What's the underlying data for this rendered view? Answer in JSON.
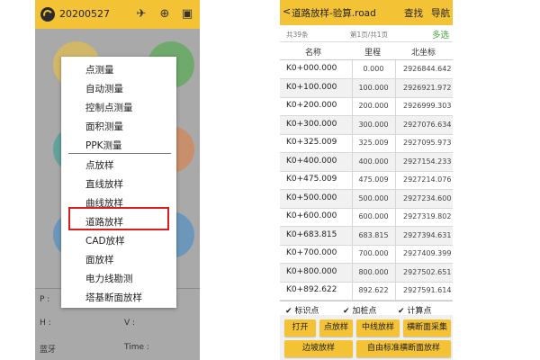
{
  "left": {
    "code": "20200527",
    "menu": {
      "items": [
        "点测量",
        "自动测量",
        "控制点测量",
        "面积测量",
        "PPK测量",
        "点放样",
        "直线放样",
        "曲线放样",
        "道路放样",
        "CAD放样",
        "面放样",
        "电力线勘测",
        "塔基断面放样"
      ],
      "highlighted_index": 8
    },
    "info": {
      "p": "P :",
      "h": "H :",
      "v": "V :",
      "bluetooth": "蓝牙",
      "time": "Time :"
    }
  },
  "right": {
    "title": "道路放样-验算.road",
    "back": "<",
    "find": "查找",
    "nav": "导航",
    "total": "共39条",
    "page": "第1页/共1页",
    "multi_select": "多选",
    "columns": [
      "名称",
      "里程",
      "北坐标"
    ],
    "rows": [
      [
        "K0+000.000",
        "0.000",
        "2926844.642"
      ],
      [
        "K0+100.000",
        "100.000",
        "2926921.972"
      ],
      [
        "K0+200.000",
        "200.000",
        "2926999.303"
      ],
      [
        "K0+300.000",
        "300.000",
        "2927076.634"
      ],
      [
        "K0+325.009",
        "325.009",
        "2927095.973"
      ],
      [
        "K0+400.000",
        "400.000",
        "2927154.233"
      ],
      [
        "K0+475.009",
        "475.009",
        "2927214.076"
      ],
      [
        "K0+500.000",
        "500.000",
        "2927234.600"
      ],
      [
        "K0+600.000",
        "600.000",
        "2927319.802"
      ],
      [
        "K0+683.815",
        "683.815",
        "2927394.631"
      ],
      [
        "K0+700.000",
        "700.000",
        "2927409.399"
      ],
      [
        "K0+800.000",
        "800.000",
        "2927502.651"
      ],
      [
        "K0+892.622",
        "892.622",
        "2927591.614"
      ]
    ],
    "checks": [
      {
        "label": "标识点",
        "checked": true
      },
      {
        "label": "加桩点",
        "checked": true
      },
      {
        "label": "计算点",
        "checked": true
      }
    ],
    "buttons_row1": [
      "打开",
      "点放样",
      "中线放样",
      "横断面采集"
    ],
    "buttons_row2": [
      "边坡放样",
      "自由标准横断面放样"
    ],
    "colors": {
      "accent": "#f4c235",
      "highlight": "#d81e1e",
      "green": "#3fa93a"
    }
  }
}
